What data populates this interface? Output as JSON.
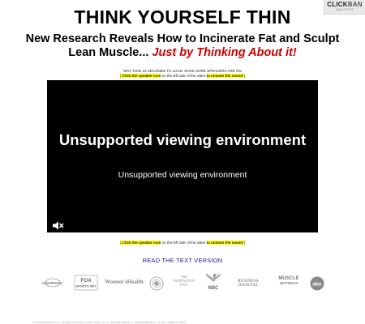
{
  "badge": {
    "brand_dark": "CLICK",
    "brand_light": "BAN",
    "sub": "ANALYTICS"
  },
  "title": "THINK YOURSELF THIN",
  "headline": {
    "line1": "New Research Reveals How to Incinerate Fat and Sculpt",
    "line2_plain": "Lean Muscle... ",
    "line2_red": "Just by Thinking About it!"
  },
  "note_top": {
    "line1": "MAY TAKE 10 SECONDS TO LOAD. MAKE SURE SPEAKERS ARE ON",
    "bracket_open": "[ ",
    "click_bold": "Click the speaker icon",
    "middle": " on the left side of the video ",
    "unmute_bold": "to unmute the sound",
    "bracket_close": " ]"
  },
  "video": {
    "message_title": "Unsupported viewing environment",
    "message_sub": "Unsupported viewing environment",
    "mute_icon": "speaker-muted-icon"
  },
  "note_bottom": {
    "bracket_open": "[ ",
    "click_bold": "Click the speaker icon",
    "middle": " on the left side of the video ",
    "unmute_bold": "to unmute the sound",
    "bracket_close": " ]"
  },
  "read_link": "READ THE TEXT VERSION",
  "logos": [
    "UNIVERSAL",
    "FOX SPORTS NET",
    "Women'sHealth",
    "emblem-logo",
    "THE HUFFINGTON POST",
    "NBC",
    "BUSINESS JOURNAL",
    "MUSCLE & FITNESS",
    "abc"
  ],
  "footer": "© ThinkYourselfThin.com - All Rights Reserved - Privacy Policy - Terms - Earnings Disclaimer - Medical Disclaimer - Contact - Affiliates - DMCA"
}
